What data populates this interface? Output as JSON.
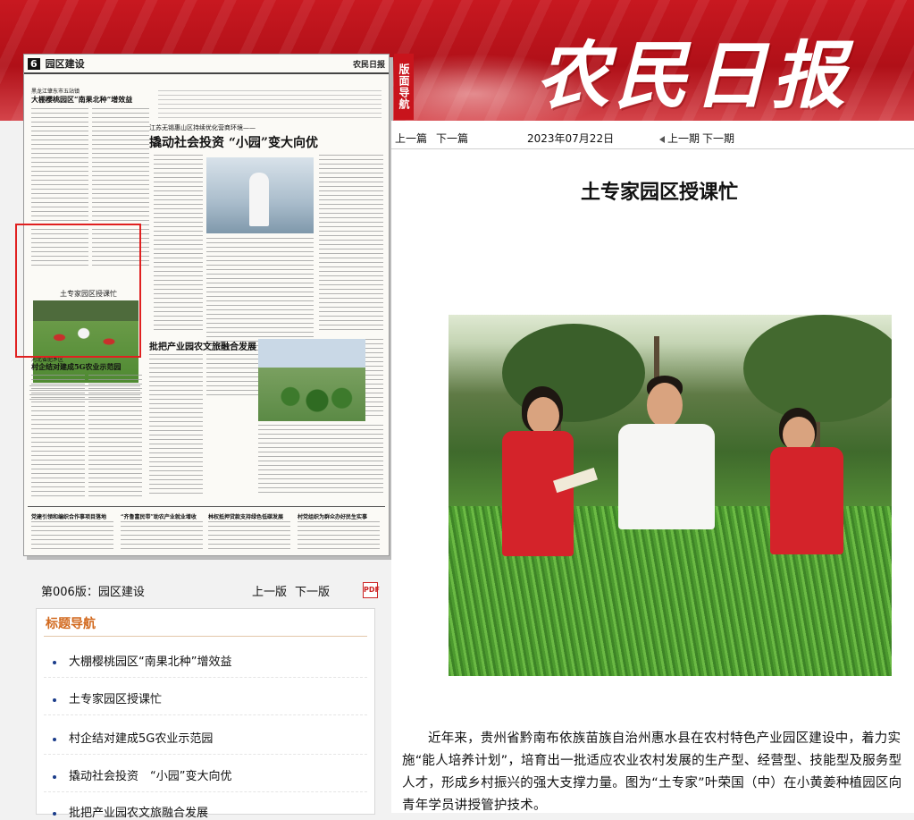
{
  "masthead": "农民日报",
  "side_tag": "版面导航",
  "topnav": {
    "prev_article": "上一篇",
    "next_article": "下一篇",
    "date": "2023年07月22日",
    "prev_issue": "上一期",
    "next_issue": "下一期"
  },
  "article": {
    "title": "土专家园区授课忙",
    "caption": "近年来，贵州省黔南布依族苗族自治州惠水县在农村特色产业园区建设中，着力实施“能人培养计划”，培育出一批适应农业农村发展的生产型、经营型、技能型及服务型人才，形成乡村振兴的强大支撑力量。图为“土专家”叶荣国（中）在小黄姜种植园区向青年学员讲授管护技术。"
  },
  "paper": {
    "page_no": "6",
    "section": "园区建设",
    "masthead_small": "农民日报",
    "headline_main": "撬动社会投资 “小园”变大向优",
    "headline_sub": "江苏无锡惠山区持续优化营商环境——",
    "headline_left": "大棚樱桃园区“南果北种”增效益",
    "headline_left_sub": "黑龙江肇东市五站镇",
    "highlight_title": "土专家园区授课忙",
    "headline_bottom": "批把产业园农文旅融合发展",
    "headline_bottom_left": "村企结对建成5G农业示范园",
    "headline_bottom_left_sub": "河北省肥乡区",
    "bottom_heads": [
      "党建引领和编织合作事项目落地",
      "“齐鲁富民带”助农产业就业增收",
      "林权抵押贷款支持绿色低碳发展",
      "村党组织为群众办好民生实事"
    ]
  },
  "pagebar": {
    "label": "第006版：园区建设",
    "prev_page": "上一版",
    "next_page": "下一版",
    "pdf": "PDF"
  },
  "navbox": {
    "title": "标题导航",
    "items": [
      "大棚樱桃园区“南果北种”增效益",
      "土专家园区授课忙",
      "村企结对建成5G农业示范园",
      "撬动社会投资　“小园”变大向优",
      "批把产业园农文旅融合发展"
    ]
  },
  "colors": {
    "banner_red": "#c8141c",
    "nav_title_orange": "#d2691e",
    "highlight_red": "#e02020"
  }
}
